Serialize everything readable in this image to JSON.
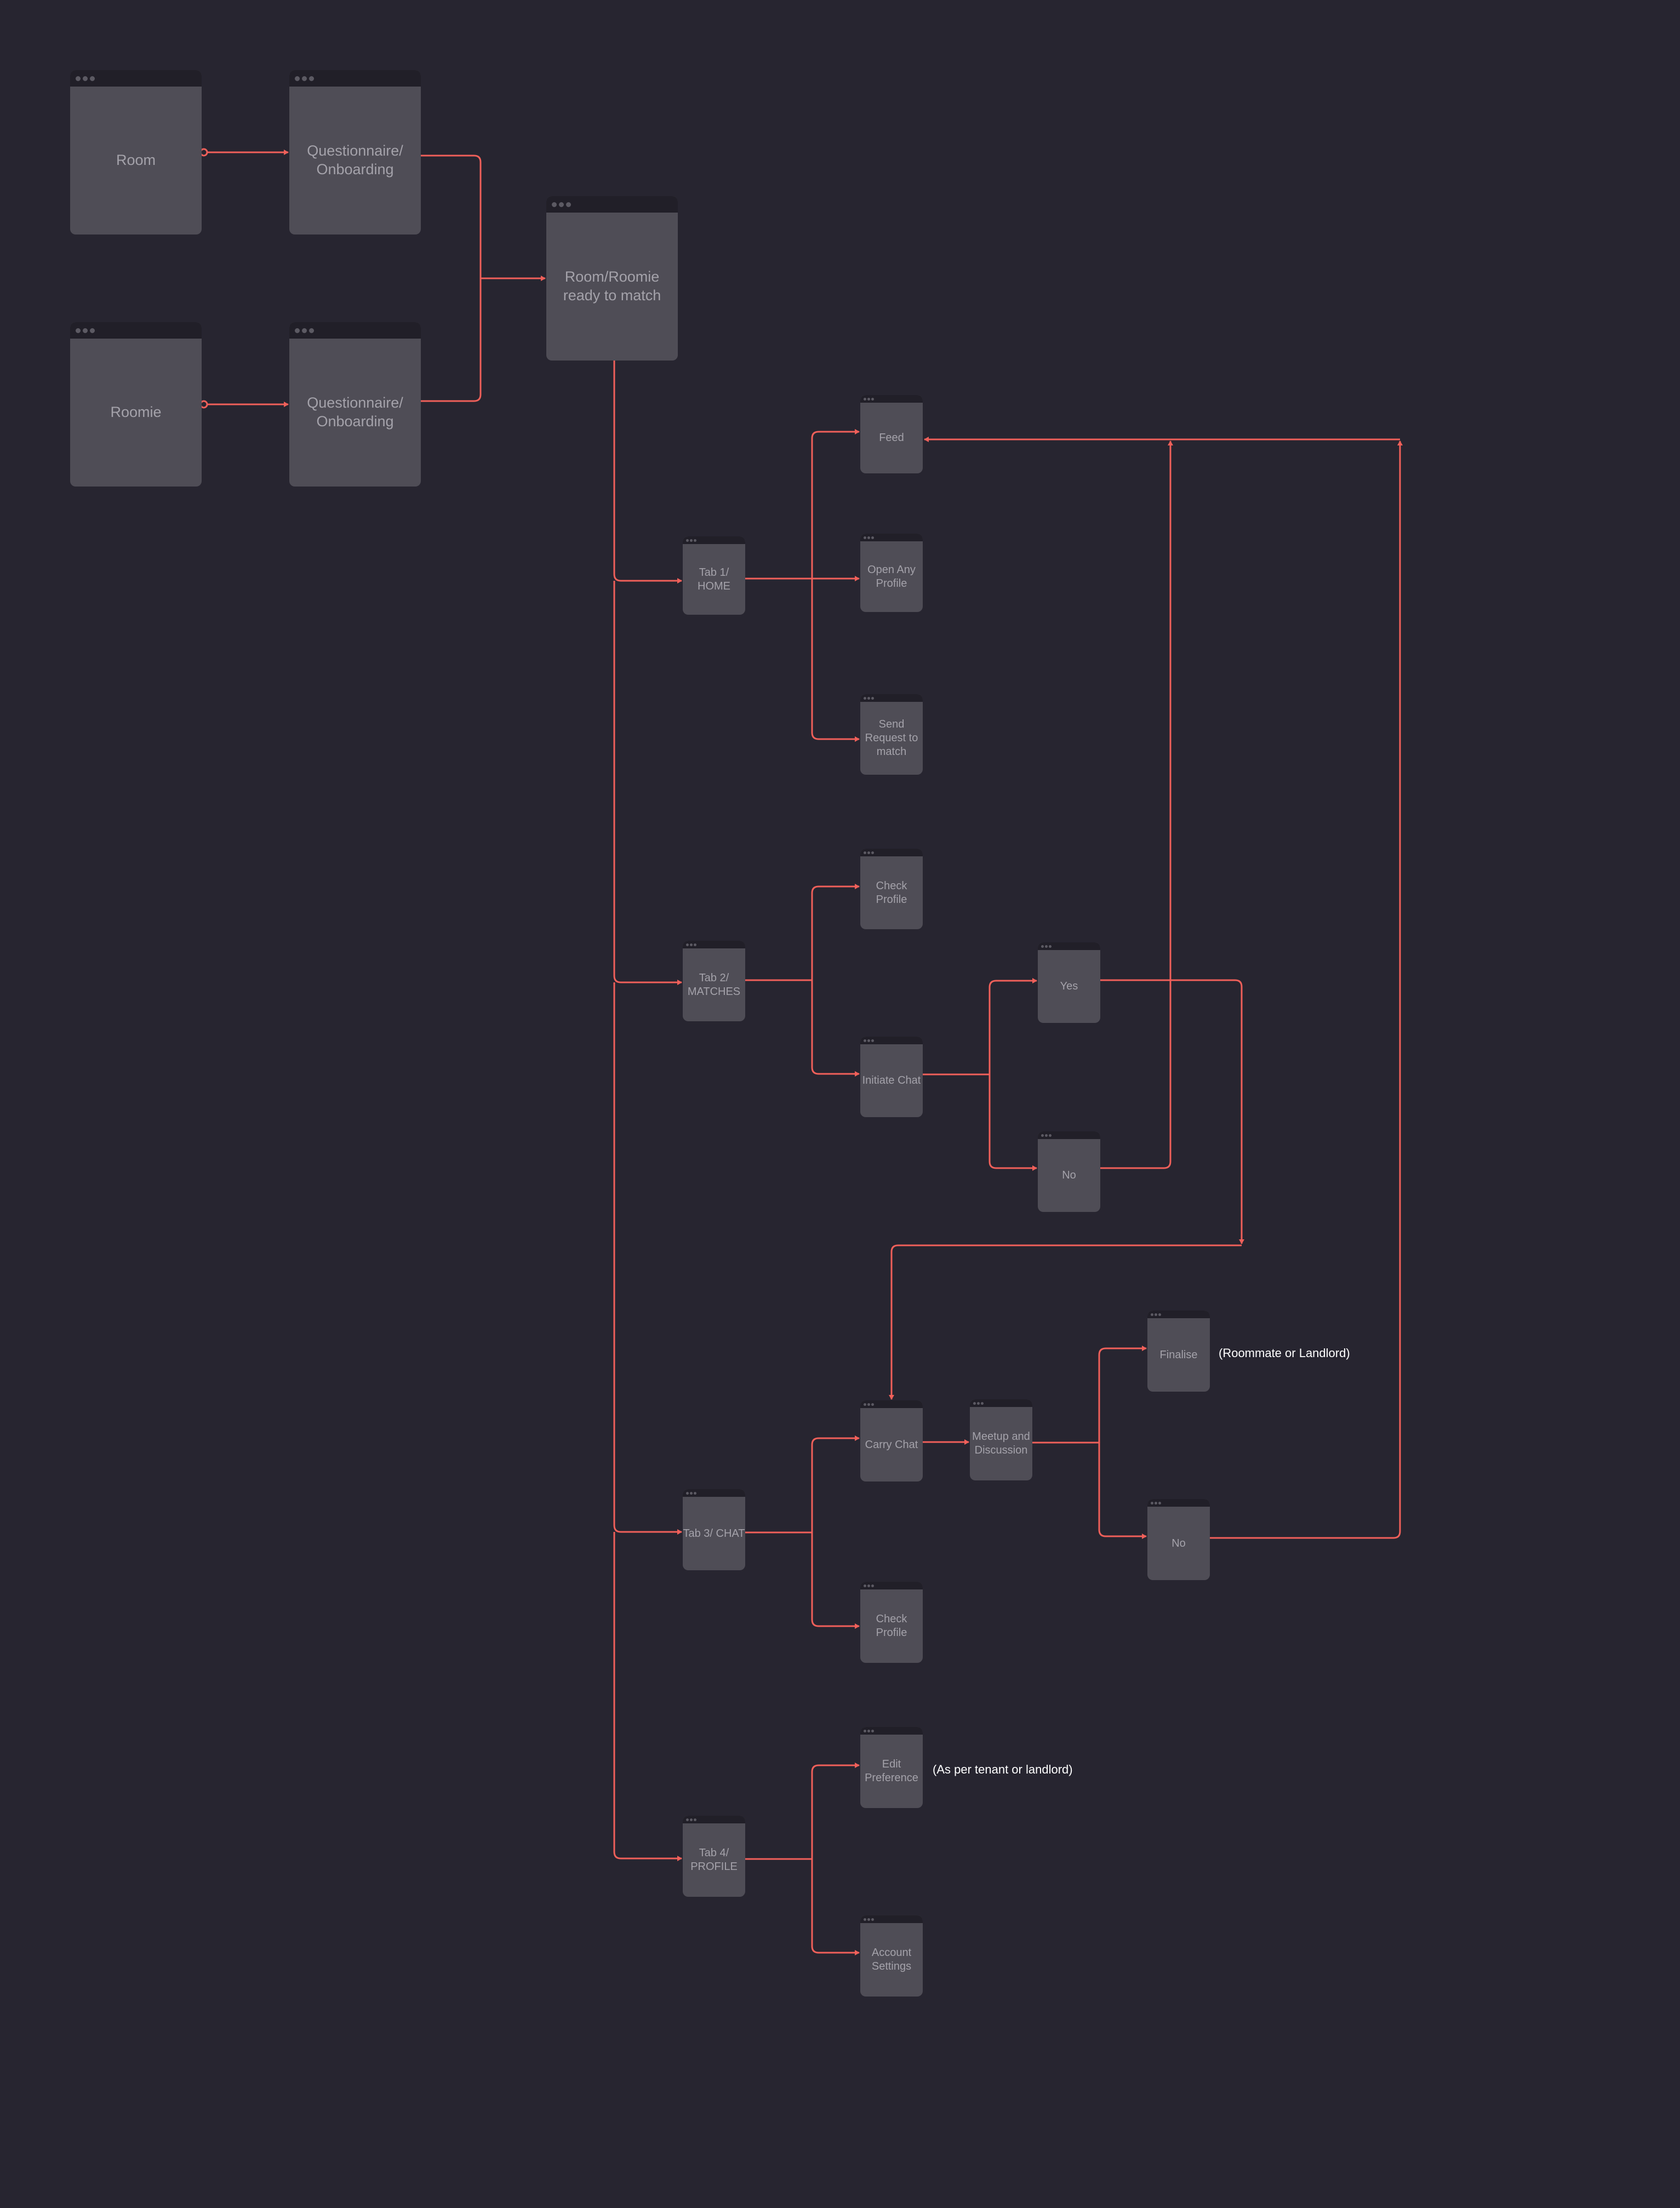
{
  "colors": {
    "background": "#272530",
    "screen": "#4f4d56",
    "screen_header": "#211f28",
    "connector": "#f0605a",
    "label": "#a4a2aa",
    "note": "#ffffff"
  },
  "nodes": {
    "room": "Room",
    "roomie": "Roomie",
    "questionnaire_room": "Questionnaire/ Onboarding",
    "questionnaire_roomie": "Questionnaire/ Onboarding",
    "ready": "Room/Roomie ready to match",
    "tab1": "Tab 1/ HOME",
    "feed": "Feed",
    "open_profile": "Open Any Profile",
    "send_request": "Send Request to match",
    "tab2": "Tab 2/ MATCHES",
    "check_profile_matches": "Check Profile",
    "initiate_chat": "Initiate Chat",
    "yes": "Yes",
    "no_chat": "No",
    "tab3": "Tab 3/ CHAT",
    "carry_chat": "Carry Chat",
    "meetup": "Meetup and Discussion",
    "finalise": "Finalise",
    "no_meetup": "No",
    "check_profile_chat": "Check Profile",
    "tab4": "Tab 4/ PROFILE",
    "edit_preference": "Edit Preference",
    "account_settings": "Account Settings"
  },
  "notes": {
    "finalise_note": "(Roommate or Landlord)",
    "edit_preference_note": "(As per tenant or landlord)"
  }
}
